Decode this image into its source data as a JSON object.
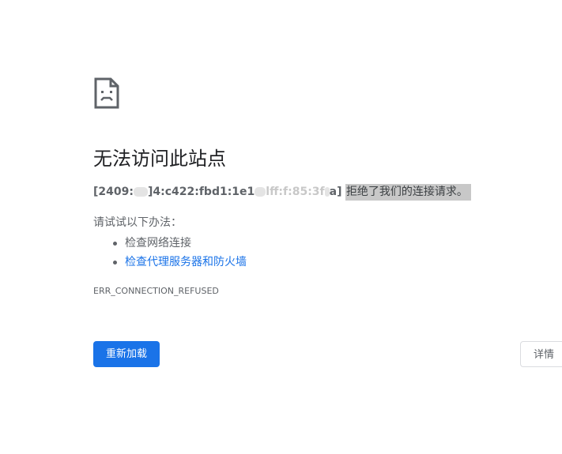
{
  "icon": "sad-page-icon",
  "heading": "无法访问此站点",
  "summary": {
    "host_part1": "[2409:",
    "host_part2": "]4:c422:fbd1:1e1",
    "host_part3": "lff:f:85:3f",
    "host_part4": "a]",
    "message": "拒绝了我们的连接请求。"
  },
  "suggestions": {
    "title": "请试试以下办法：",
    "items": [
      {
        "label": "检查网络连接"
      },
      {
        "label": "检查代理服务器和防火墙"
      }
    ]
  },
  "error_code": "ERR_CONNECTION_REFUSED",
  "buttons": {
    "reload": "重新加载",
    "details": "详情"
  },
  "colors": {
    "primary": "#1a73e8",
    "text": "#202124",
    "secondary_text": "#5f6368",
    "highlight": "#c8c8c8"
  }
}
